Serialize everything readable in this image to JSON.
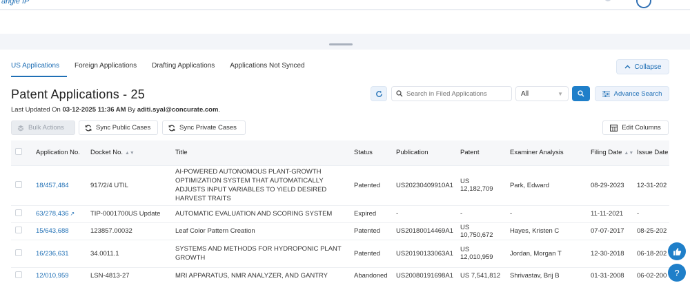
{
  "app": {
    "logo_text": "angle IP"
  },
  "tabs": [
    {
      "label": "US Applications"
    },
    {
      "label": "Foreign Applications"
    },
    {
      "label": "Drafting Applications"
    },
    {
      "label": "Applications Not Synced"
    }
  ],
  "collapse_label": "Collapse",
  "page": {
    "title": "Patent Applications - 25",
    "updated_prefix": "Last Updated On ",
    "updated_datetime": "03-12-2025 11:36 AM",
    "updated_by_prefix": " By ",
    "updated_by": "aditi.syal@concurate.com",
    "updated_suffix": "."
  },
  "search": {
    "placeholder": "Search in Filed Applications",
    "filter_value": "All",
    "advanced_label": "Advance Search"
  },
  "toolbar": {
    "bulk_actions": "Bulk Actions",
    "sync_public": "Sync Public Cases",
    "sync_private": "Sync Private Cases",
    "edit_columns": "Edit Columns"
  },
  "table": {
    "headers": [
      "Application No.",
      "Docket No.",
      "Title",
      "Status",
      "Publication",
      "Patent",
      "Examiner Analysis",
      "Filing Date",
      "Issue Date"
    ],
    "rows": [
      {
        "app_no": "18/457,484",
        "docket": "917/2/4 UTIL",
        "title": "AI-POWERED AUTONOMOUS PLANT-GROWTH OPTIMIZATION SYSTEM THAT AUTOMATICALLY ADJUSTS INPUT VARIABLES TO YIELD DESIRED HARVEST TRAITS",
        "status": "Patented",
        "publication": "US20230409910A1",
        "patent": "US 12,182,709",
        "examiner": "Park, Edward",
        "filing": "08-29-2023",
        "issue": "12-31-202"
      },
      {
        "app_no": "63/278,436",
        "docket": "TIP-0001700US Update",
        "title": "AUTOMATIC EVALUATION AND SCORING SYSTEM",
        "status": "Expired",
        "publication": "-",
        "patent": "-",
        "examiner": "-",
        "filing": "11-11-2021",
        "issue": "-"
      },
      {
        "app_no": "15/643,688",
        "docket": "123857.00032",
        "title": "Leaf Color Pattern Creation",
        "status": "Patented",
        "publication": "US20180014469A1",
        "patent": "US 10,750,672",
        "examiner": "Hayes, Kristen C",
        "filing": "07-07-2017",
        "issue": "08-25-202"
      },
      {
        "app_no": "16/236,631",
        "docket": "34.0011.1",
        "title": "SYSTEMS AND METHODS FOR HYDROPONIC PLANT GROWTH",
        "status": "Patented",
        "publication": "US20190133063A1",
        "patent": "US 12,010,959",
        "examiner": "Jordan, Morgan T",
        "filing": "12-30-2018",
        "issue": "06-18-202"
      },
      {
        "app_no": "12/010,959",
        "docket": "LSN-4813-27",
        "title": "MRI APPARATUS, NMR ANALYZER, AND GANTRY",
        "status": "Abandoned",
        "publication": "US20080191698A1",
        "patent": "US 7,541,812",
        "examiner": "Shrivastav, Brij B",
        "filing": "01-31-2008",
        "issue": "06-02-200"
      }
    ]
  },
  "help_label": "?",
  "colors": {
    "accent": "#1f6fb5",
    "button_blue": "#1f7fc9"
  }
}
